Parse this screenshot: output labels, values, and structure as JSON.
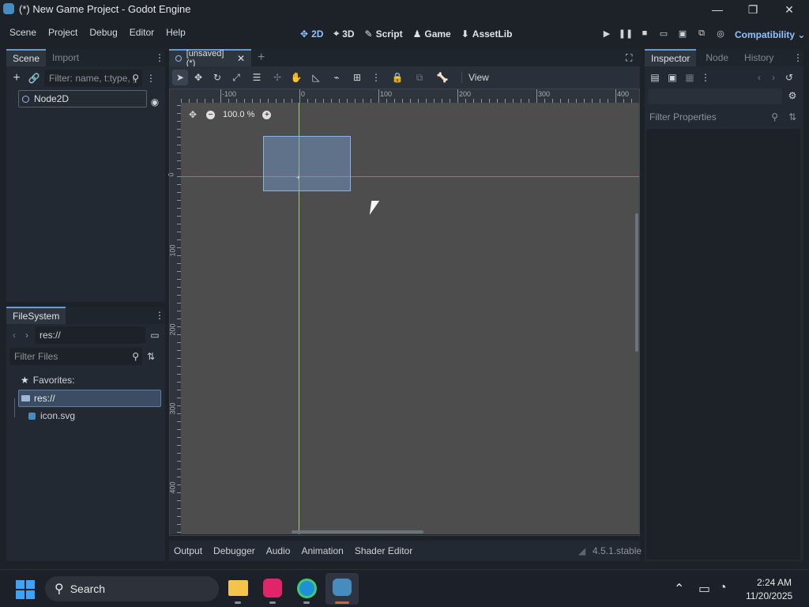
{
  "window": {
    "title": "(*) New Game Project - Godot Engine",
    "min_glyph": "—",
    "max_glyph": "❐",
    "close_glyph": "✕"
  },
  "menu": [
    "Scene",
    "Project",
    "Debug",
    "Editor",
    "Help"
  ],
  "workspaces": [
    {
      "label": "2D",
      "icon": "2d-icon",
      "glyph": "✥"
    },
    {
      "label": "3D",
      "icon": "3d-icon",
      "glyph": "⌖"
    },
    {
      "label": "Script",
      "icon": "script-icon",
      "glyph": "✎"
    },
    {
      "label": "Game",
      "icon": "game-icon",
      "glyph": "♟"
    },
    {
      "label": "AssetLib",
      "icon": "assetlib-icon",
      "glyph": "⬇"
    }
  ],
  "renderer": "Compatibility",
  "scene_dock": {
    "tabs": [
      "Scene",
      "Import"
    ],
    "filter_placeholder": "Filter: name, t:type, g:",
    "root_node": "Node2D"
  },
  "filesystem_dock": {
    "tab": "FileSystem",
    "path": "res://",
    "filter_placeholder": "Filter Files",
    "favorites_label": "Favorites:",
    "tree": [
      {
        "label": "res://",
        "selected": true
      },
      {
        "label": "icon.svg",
        "selected": false
      }
    ]
  },
  "editor_tabs": {
    "scene_tab": "[unsaved](*)",
    "view_menu": "View"
  },
  "viewport": {
    "zoom": "100.0 %",
    "h_ruler_labels": [
      "-100",
      "0",
      "100",
      "200",
      "300",
      "400"
    ],
    "v_ruler_labels": [
      "0",
      "100",
      "200",
      "300",
      "400"
    ]
  },
  "bottom_panel": {
    "tabs": [
      "Output",
      "Debugger",
      "Audio",
      "Animation",
      "Shader Editor"
    ],
    "version": "4.5.1.stable"
  },
  "inspector_dock": {
    "tabs": [
      "Inspector",
      "Node",
      "History"
    ],
    "filter_placeholder": "Filter Properties"
  },
  "taskbar": {
    "search_label": "Search",
    "time": "2:24 AM",
    "date": "11/20/2025"
  },
  "colors": {
    "accent": "#5b9de0",
    "viewport_bg": "#4d4d4d",
    "x_axis": "#d9546c",
    "y_axis": "#a3d36a"
  }
}
